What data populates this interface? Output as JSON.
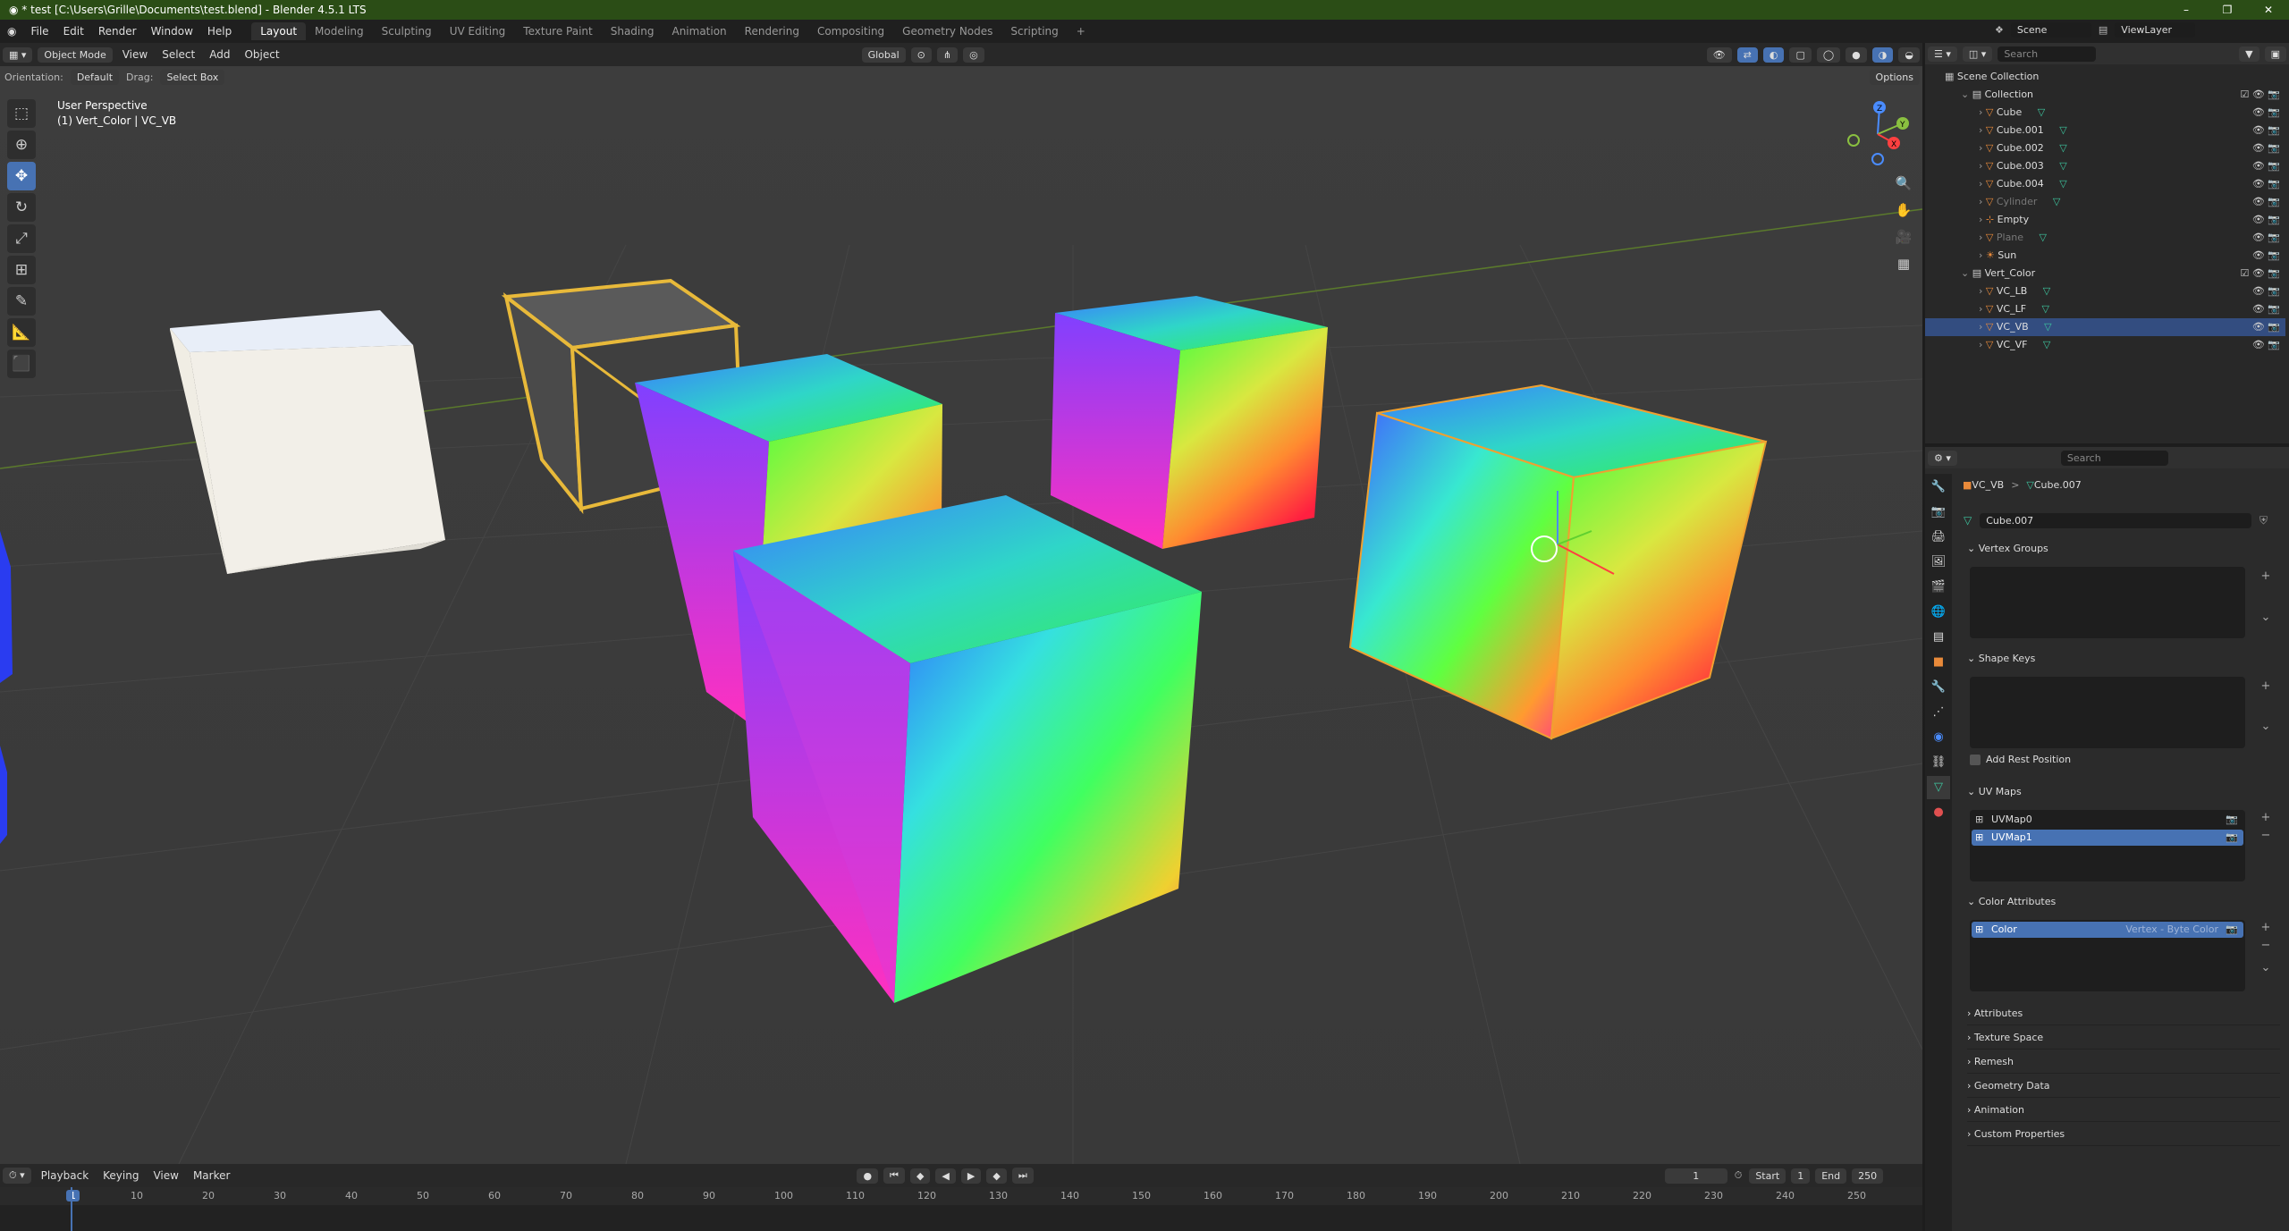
{
  "window": {
    "title": "* test [C:\\Users\\Grille\\Documents\\test.blend] - Blender 4.5.1 LTS",
    "min_glyph": "–",
    "max_glyph": "❐",
    "close_glyph": "✕"
  },
  "menu": [
    "File",
    "Edit",
    "Render",
    "Window",
    "Help"
  ],
  "workspaces": [
    "Layout",
    "Modeling",
    "Sculpting",
    "UV Editing",
    "Texture Paint",
    "Shading",
    "Animation",
    "Rendering",
    "Compositing",
    "Geometry Nodes",
    "Scripting"
  ],
  "workspace_add": "+",
  "scene": {
    "label": "Scene",
    "view_layer": "ViewLayer"
  },
  "viewport_header": {
    "mode": "Object Mode",
    "menus": [
      "View",
      "Select",
      "Add",
      "Object"
    ],
    "transform": "Global",
    "orientation_label": "Orientation:",
    "orientation_value": "Default",
    "drag_label": "Drag:",
    "drag_value": "Select Box",
    "options": "Options"
  },
  "viewport_info": {
    "line1": "User Perspective",
    "line2": "(1) Vert_Color | VC_VB"
  },
  "gizmo": {
    "x": "X",
    "y": "Y",
    "z": "Z"
  },
  "timeline_header": {
    "menus": [
      "Playback",
      "Keying",
      "View",
      "Marker"
    ],
    "current_frame": "1",
    "start_label": "Start",
    "start": "1",
    "end_label": "End",
    "end": "250"
  },
  "timeline_ticks": [
    "1",
    "10",
    "20",
    "30",
    "40",
    "50",
    "60",
    "70",
    "80",
    "90",
    "100",
    "110",
    "120",
    "130",
    "140",
    "150",
    "160",
    "170",
    "180",
    "190",
    "200",
    "210",
    "220",
    "230",
    "240",
    "250"
  ],
  "outliner": {
    "search_placeholder": "Search",
    "root": "Scene Collection",
    "rows": [
      {
        "label": "Collection",
        "kind": "collection",
        "level": 1
      },
      {
        "label": "Cube",
        "kind": "mesh",
        "level": 2
      },
      {
        "label": "Cube.001",
        "kind": "mesh",
        "level": 2
      },
      {
        "label": "Cube.002",
        "kind": "mesh",
        "level": 2
      },
      {
        "label": "Cube.003",
        "kind": "mesh",
        "level": 2
      },
      {
        "label": "Cube.004",
        "kind": "mesh",
        "level": 2
      },
      {
        "label": "Cylinder",
        "kind": "mesh",
        "level": 2,
        "dim": true
      },
      {
        "label": "Empty",
        "kind": "empty",
        "level": 2
      },
      {
        "label": "Plane",
        "kind": "mesh",
        "level": 2,
        "dim": true
      },
      {
        "label": "Sun",
        "kind": "light",
        "level": 2
      },
      {
        "label": "Vert_Color",
        "kind": "collection",
        "level": 1
      },
      {
        "label": "VC_LB",
        "kind": "mesh",
        "level": 2
      },
      {
        "label": "VC_LF",
        "kind": "mesh",
        "level": 2
      },
      {
        "label": "VC_VB",
        "kind": "mesh",
        "level": 2,
        "selected": true
      },
      {
        "label": "VC_VF",
        "kind": "mesh",
        "level": 2
      }
    ]
  },
  "properties": {
    "search_placeholder": "Search",
    "breadcrumb_object": "VC_VB",
    "breadcrumb_sep": ">",
    "breadcrumb_mesh": "Cube.007",
    "mesh_name": "Cube.007",
    "panels": {
      "vertex_groups": "Vertex Groups",
      "shape_keys": "Shape Keys",
      "add_rest_position": "Add Rest Position",
      "uv_maps": "UV Maps",
      "uv_items": [
        "UVMap0",
        "UVMap1"
      ],
      "color_attributes": "Color Attributes",
      "color_item": "Color",
      "color_item_domain": "Vertex - Byte Color",
      "collapsed": [
        "Attributes",
        "Texture Space",
        "Remesh",
        "Geometry Data",
        "Animation",
        "Custom Properties"
      ]
    }
  },
  "colors": {
    "accent": "#4772b3",
    "titlebar": "#2b4d16",
    "selected_outline": "#f0a030",
    "active_frame": "#4772b3",
    "mesh_icon": "#3ec7a0",
    "object_icon": "#e98a3a"
  }
}
